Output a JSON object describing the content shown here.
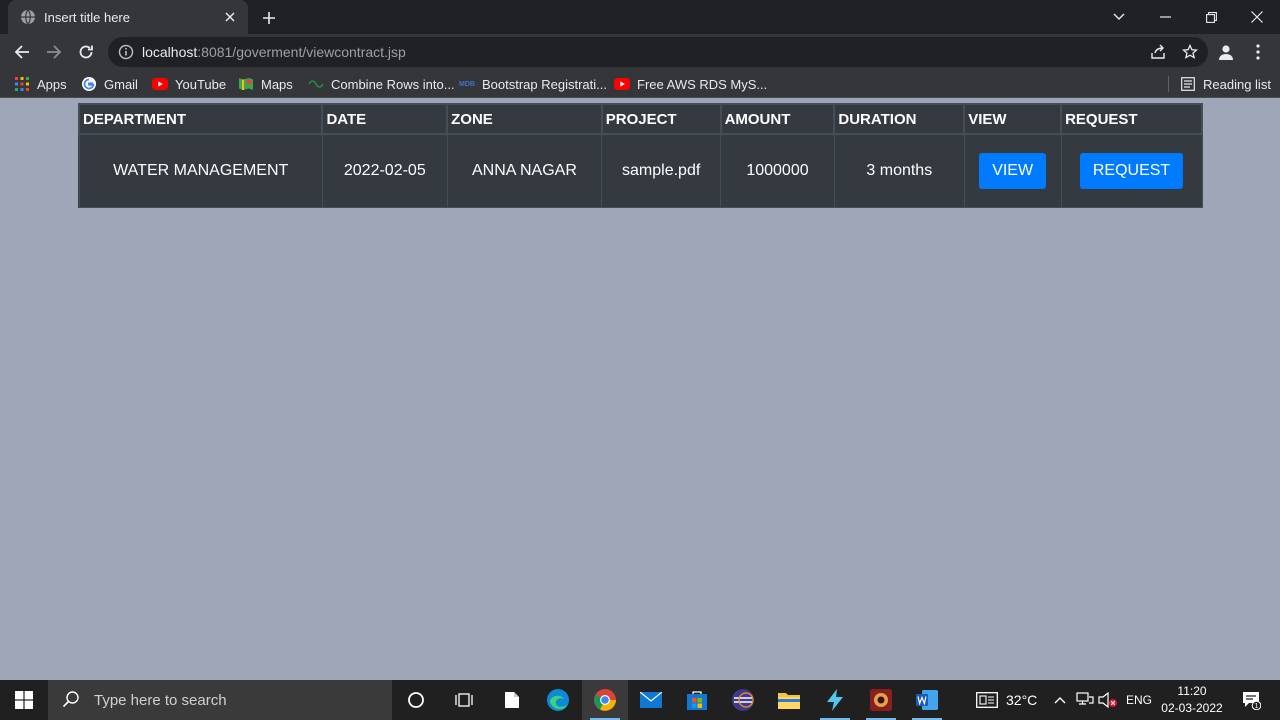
{
  "browser": {
    "tab_title": "Insert title here",
    "url_host": "localhost",
    "url_rest": ":8081/goverment/viewcontract.jsp",
    "bookmarks": [
      {
        "label": "Apps",
        "icon": "apps-grid-icon"
      },
      {
        "label": "Gmail",
        "icon": "google-icon"
      },
      {
        "label": "YouTube",
        "icon": "youtube-icon"
      },
      {
        "label": "Maps",
        "icon": "maps-icon"
      },
      {
        "label": "Combine Rows into...",
        "icon": "link-icon"
      },
      {
        "label": "Bootstrap Registrati...",
        "icon": "mdb-icon"
      },
      {
        "label": "Free AWS RDS MyS...",
        "icon": "youtube-icon"
      }
    ],
    "reading_list": "Reading list"
  },
  "table": {
    "headers": [
      "DEPARTMENT",
      "DATE",
      "ZONE",
      "PROJECT",
      "AMOUNT",
      "DURATION",
      "VIEW",
      "REQUEST"
    ],
    "rows": [
      {
        "department": "WATER MANAGEMENT",
        "date": "2022-02-05",
        "zone": "ANNA NAGAR",
        "project": "sample.pdf",
        "amount": "1000000",
        "duration": "3 months",
        "view_label": "VIEW",
        "request_label": "REQUEST"
      }
    ]
  },
  "taskbar": {
    "search_placeholder": "Type here to search",
    "temperature": "32°C",
    "language": "ENG",
    "time": "11:20",
    "date": "02-03-2022",
    "notification_count": "1"
  },
  "colors": {
    "page_bg": "#9ea6b8",
    "table_bg": "#343a40",
    "button_blue": "#007bff"
  }
}
